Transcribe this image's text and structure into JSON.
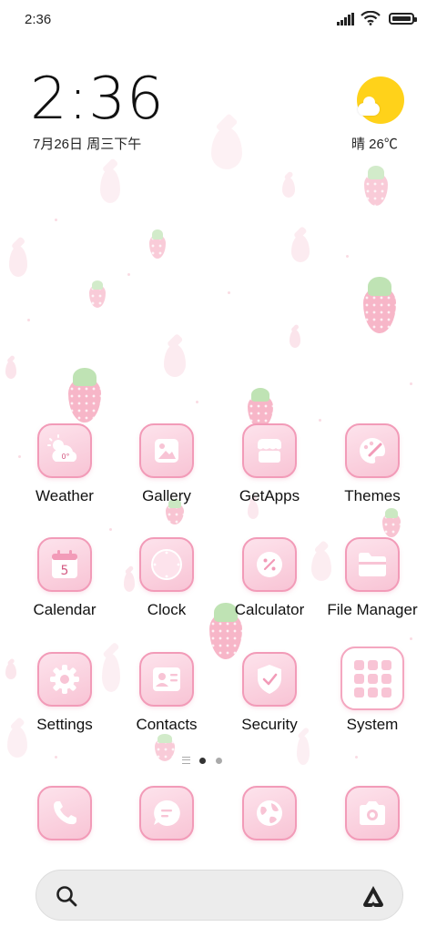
{
  "status_bar": {
    "time": "2:36"
  },
  "clock_widget": {
    "time": "2:36",
    "date": "7月26日 周三下午"
  },
  "weather_widget": {
    "temp": "晴 26℃",
    "icon": "sun-cloud-icon"
  },
  "apps": [
    {
      "label": "Weather",
      "icon": "weather-icon",
      "badge": "0°"
    },
    {
      "label": "Gallery",
      "icon": "gallery-icon"
    },
    {
      "label": "GetApps",
      "icon": "getapps-icon"
    },
    {
      "label": "Themes",
      "icon": "themes-icon"
    },
    {
      "label": "Calendar",
      "icon": "calendar-icon",
      "badge": "5"
    },
    {
      "label": "Clock",
      "icon": "clock-icon"
    },
    {
      "label": "Calculator",
      "icon": "calculator-icon"
    },
    {
      "label": "File Manager",
      "icon": "folder-icon"
    },
    {
      "label": "Settings",
      "icon": "gear-icon"
    },
    {
      "label": "Contacts",
      "icon": "contacts-icon"
    },
    {
      "label": "Security",
      "icon": "shield-icon"
    },
    {
      "label": "System",
      "icon": "system-folder-icon"
    }
  ],
  "dock": [
    {
      "icon": "phone-icon"
    },
    {
      "icon": "message-icon"
    },
    {
      "icon": "browser-icon"
    },
    {
      "icon": "camera-icon"
    }
  ],
  "search_bar": {
    "left_icon": "search-icon",
    "right_icon": "assistant-icon"
  },
  "colors": {
    "accent": "#f29bb8",
    "icon_fill": "#f8c4d5",
    "sun": "#ffd21a"
  }
}
